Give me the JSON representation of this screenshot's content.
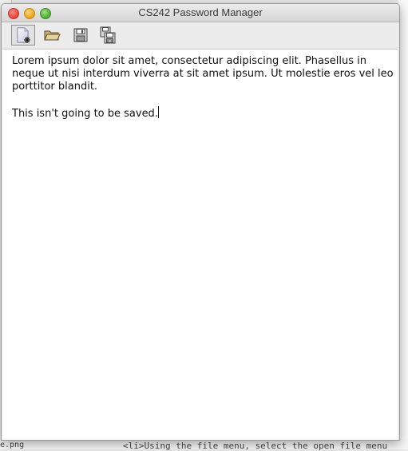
{
  "window": {
    "title": "CS242 Password Manager"
  },
  "toolbar": {
    "buttons": [
      {
        "name": "new-file-button",
        "icon": "new-document-icon"
      },
      {
        "name": "open-file-button",
        "icon": "folder-icon"
      },
      {
        "name": "save-button",
        "icon": "floppy-disk-icon"
      },
      {
        "name": "save-as-button",
        "icon": "floppy-disk-save-as-icon"
      }
    ]
  },
  "editor": {
    "paragraph_1": "Lorem ipsum dolor sit amet, consectetur adipiscing elit. Phasellus in neque ut nisi interdum viverra at sit amet ipsum. Ut molestie eros vel leo porttitor blandit.",
    "paragraph_2": "This isn't going to be saved."
  },
  "background": {
    "bottom_text": "<li>Using the file menu, select the open file menu",
    "bottom_left_text": "e.png"
  }
}
